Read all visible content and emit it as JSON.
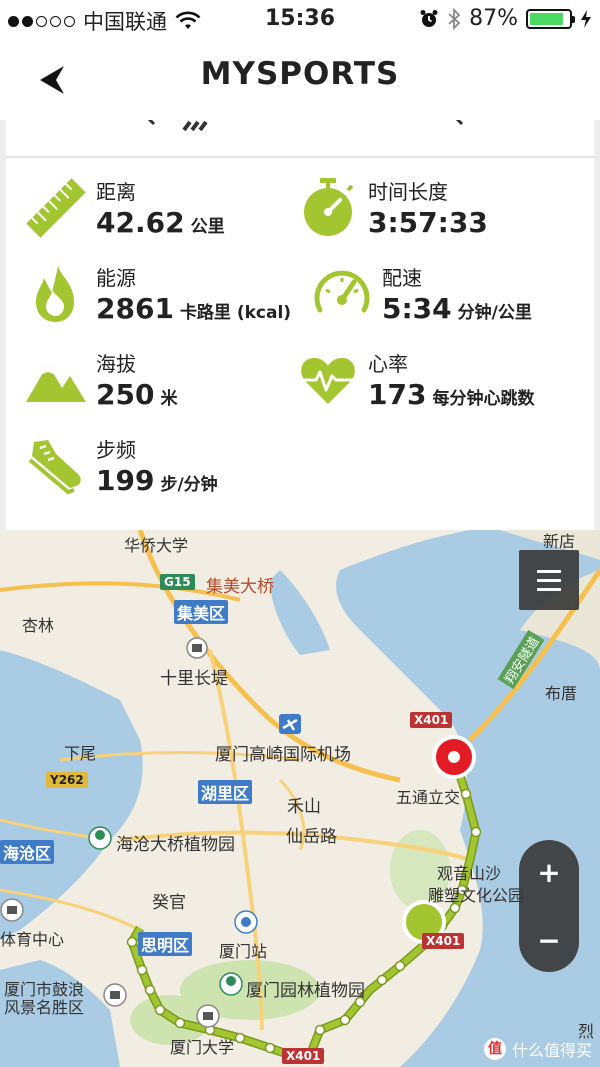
{
  "status_bar": {
    "carrier": "中国联通",
    "time": "15:36",
    "battery": "87%",
    "battery_level": 0.87
  },
  "nav": {
    "title": "MYSPORTS"
  },
  "stats": {
    "distance": {
      "label": "距离",
      "value": "42.62",
      "unit": "公里"
    },
    "duration": {
      "label": "时间长度",
      "value": "3:57:33",
      "unit": ""
    },
    "energy": {
      "label": "能源",
      "value": "2861",
      "unit": "卡路里 (kcal)"
    },
    "pace": {
      "label": "配速",
      "value": "5:34",
      "unit": "分钟/公里"
    },
    "elevation": {
      "label": "海拔",
      "value": "250",
      "unit": "米"
    },
    "heart_rate": {
      "label": "心率",
      "value": "173",
      "unit": "每分钟心跳数"
    },
    "cadence": {
      "label": "步频",
      "value": "199",
      "unit": "步/分钟"
    }
  },
  "map": {
    "labels": {
      "huaqiao": "华侨大学",
      "xindian": "新店",
      "jimei_bridge": "集美大桥",
      "jimei_district": "集美区",
      "xinglin": "杏林",
      "shili": "十里长堤",
      "bucuo": "布厝",
      "xingan": "翔安隧道",
      "airport": "厦门高崎国际机场",
      "xiawei": "下尾",
      "huli_district": "湖里区",
      "wutong": "五通立交",
      "hecang": "禾山",
      "xianyue": "仙岳路",
      "haicang_district": "海沧区",
      "haicang_garden": "海沧大桥植物园",
      "guanyinshan": "观音山沙",
      "park": "雕塑文化公园",
      "kuiguan": "癸官",
      "siming_district": "思明区",
      "xiamen_station": "厦门站",
      "sports_center": "体育中心",
      "gulangyu": "厦门市鼓浪",
      "scenic": "风景名胜区",
      "botanical": "厦门园林植物园",
      "xiada": "厦门大学",
      "lie": "烈"
    },
    "badges": {
      "g15": "G15",
      "x401_top": "X401",
      "y262": "Y262",
      "x401_mid": "X401",
      "x401_bot": "X401"
    },
    "zoom_in": "+",
    "zoom_out": "−",
    "watermark": "什么值得买",
    "watermark_badge": "值",
    "colors": {
      "sea": "#a9cbe3",
      "land": "#f1ede2",
      "route": "#a3c52f",
      "start_marker": "#a3c52f",
      "end_marker": "#e21b24"
    }
  }
}
